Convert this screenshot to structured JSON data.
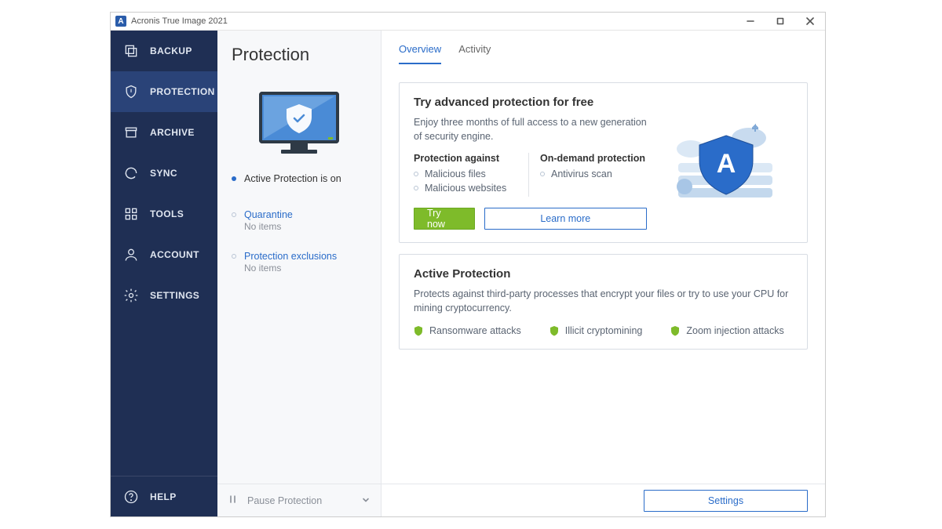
{
  "window": {
    "title": "Acronis True Image 2021"
  },
  "sidebar": {
    "items": [
      {
        "label": "BACKUP"
      },
      {
        "label": "PROTECTION"
      },
      {
        "label": "ARCHIVE"
      },
      {
        "label": "SYNC"
      },
      {
        "label": "TOOLS"
      },
      {
        "label": "ACCOUNT"
      },
      {
        "label": "SETTINGS"
      }
    ],
    "help_label": "HELP"
  },
  "secondary": {
    "heading": "Protection",
    "status": "Active Protection is on",
    "quarantine": {
      "label": "Quarantine",
      "sub": "No items"
    },
    "exclusions": {
      "label": "Protection exclusions",
      "sub": "No items"
    },
    "pause_label": "Pause Protection"
  },
  "tabs": {
    "overview": "Overview",
    "activity": "Activity"
  },
  "promo": {
    "title": "Try advanced protection for free",
    "desc": "Enjoy three months of full access to a new generation of security engine.",
    "col1_head": "Protection against",
    "col1_items": [
      "Malicious files",
      "Malicious websites"
    ],
    "col2_head": "On-demand protection",
    "col2_items": [
      "Antivirus scan"
    ],
    "try_label": "Try now",
    "learn_label": "Learn more"
  },
  "active_card": {
    "title": "Active Protection",
    "desc": "Protects against third-party processes that encrypt your files or try to use your CPU for mining cryptocurrency.",
    "items": [
      "Ransomware attacks",
      "Illicit cryptomining",
      "Zoom injection attacks"
    ]
  },
  "footer": {
    "settings_label": "Settings"
  }
}
